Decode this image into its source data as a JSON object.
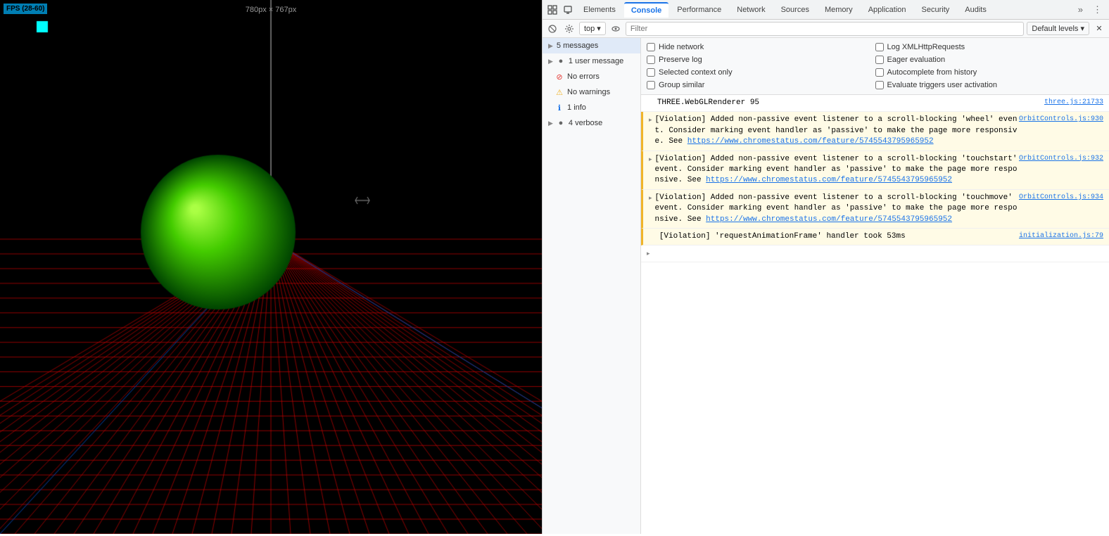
{
  "canvas": {
    "fps": "FPS (28-60)",
    "dimensions": "780px × 767px"
  },
  "devtools": {
    "tabs": [
      {
        "label": "Elements",
        "active": false
      },
      {
        "label": "Console",
        "active": true
      },
      {
        "label": "Performance",
        "active": false
      },
      {
        "label": "Network",
        "active": false
      },
      {
        "label": "Sources",
        "active": false
      },
      {
        "label": "Memory",
        "active": false
      },
      {
        "label": "Application",
        "active": false
      },
      {
        "label": "Security",
        "active": false
      },
      {
        "label": "Audits",
        "active": false
      }
    ],
    "toolbar": {
      "context": "top",
      "filter_placeholder": "Filter",
      "default_levels": "Default levels ▾"
    },
    "messages_sidebar": {
      "items": [
        {
          "label": "5 messages",
          "icon": "▶",
          "type": "all",
          "active": true
        },
        {
          "label": "1 user message",
          "icon": "●",
          "icon_color": "#666",
          "type": "user"
        },
        {
          "label": "No errors",
          "icon": "⊘",
          "icon_color": "#e53935",
          "type": "errors"
        },
        {
          "label": "No warnings",
          "icon": "⚠",
          "icon_color": "#f0b429",
          "type": "warnings"
        },
        {
          "label": "1 info",
          "icon": "ℹ",
          "icon_color": "#1a73e8",
          "type": "info"
        },
        {
          "label": "4 verbose",
          "icon": "▶",
          "icon_color": "#666",
          "type": "verbose"
        }
      ]
    },
    "console_options": {
      "col1": [
        {
          "label": "Hide network",
          "checked": false
        },
        {
          "label": "Preserve log",
          "checked": false
        },
        {
          "label": "Selected context only",
          "checked": false
        },
        {
          "label": "Group similar",
          "checked": false
        }
      ],
      "col2": [
        {
          "label": "Log XMLHttpRequests",
          "checked": false
        },
        {
          "label": "Eager evaluation",
          "checked": false
        },
        {
          "label": "Autocomplete from history",
          "checked": false
        },
        {
          "label": "Evaluate triggers user activation",
          "checked": false
        }
      ]
    },
    "log_entries": [
      {
        "type": "info",
        "expand": false,
        "content": "THREE.WebGLRenderer 95",
        "source": "three.js:21733"
      },
      {
        "type": "violation",
        "expand": true,
        "content": "▸[Violation] Added non-passive event listener to a scroll-blocking 'wheel' event. Consider marking event handler as 'passive' to make the page more responsive. See https://www.chromestatus.com/feature/5745543795965952",
        "source": "OrbitControls.js:930"
      },
      {
        "type": "violation",
        "expand": true,
        "content": "▸[Violation] Added non-passive event listener to a scroll-blocking 'touchstart' event. Consider marking event handler as 'passive' to make the page more responsive. See https://www.chromestatus.com/feature/5745543795965952",
        "source": "OrbitControls.js:932"
      },
      {
        "type": "violation",
        "expand": true,
        "content": "▸[Violation] Added non-passive event listener to a scroll-blocking 'touchmove' event. Consider marking event handler as 'passive' to make the page more responsive. See https://www.chromestatus.com/feature/5745543795965952",
        "source": "OrbitControls.js:934"
      },
      {
        "type": "violation",
        "expand": false,
        "content": "[Violation] 'requestAnimationFrame' handler took 53ms",
        "source": "initialization.js:79"
      }
    ]
  }
}
